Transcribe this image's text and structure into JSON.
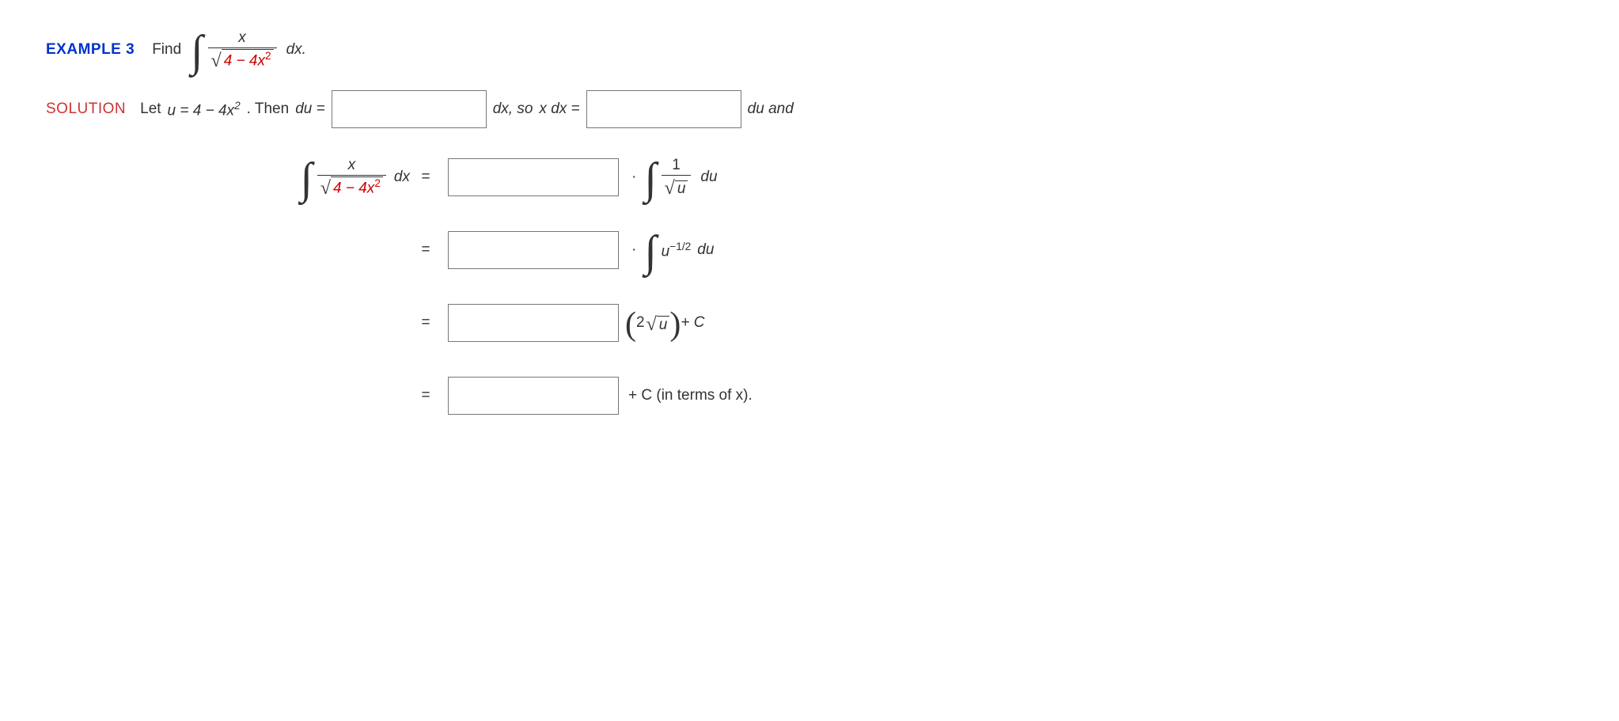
{
  "header": {
    "example_label": "EXAMPLE 3",
    "find_text": "Find",
    "integrand_num": "x",
    "integrand_den_inner": "4 − 4x",
    "integrand_den_sup": "2",
    "dx_period": "dx."
  },
  "solution": {
    "label": "SOLUTION",
    "let_text": "Let",
    "u_eq": "u = 4 − 4x",
    "u_sup": "2",
    "then_du": ".  Then",
    "du_eq": "du =",
    "dx_so": "dx,  so",
    "xdx_eq": "x dx =",
    "du_and": "du  and"
  },
  "steps": {
    "eq": "=",
    "dot": "·",
    "one": "1",
    "sqrt_u": "u",
    "du": "du",
    "u_neg_half": "u",
    "neg_half": "−1/2",
    "two": "2",
    "plus_c": " + C",
    "plus_c_terms": " + C  (in terms of x)."
  }
}
